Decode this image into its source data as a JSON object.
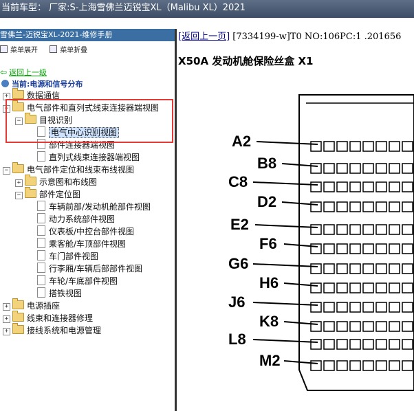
{
  "titlebar": {
    "text": "当前车型：  厂家:S-上海雪佛兰迈锐宝XL（Malibu XL）2021"
  },
  "left": {
    "header": "雪佛兰-迈锐宝XL-2021-维修手册",
    "toolbar": {
      "expand": "菜单展开",
      "collapse": "菜单折叠"
    },
    "back": "返回上一级",
    "current": "当前:电源和信号分布",
    "tree": [
      {
        "label": "数据通信",
        "type": "folder",
        "expander": "+"
      },
      {
        "label": "电气部件和直列式线束连接器端视图",
        "type": "folder",
        "expander": "−"
      },
      {
        "label": "目视识别",
        "type": "folder",
        "expander": "−"
      },
      {
        "label": "电气中心识别视图",
        "type": "doc",
        "selected": true
      },
      {
        "label": "部件连接器端视图",
        "type": "doc"
      },
      {
        "label": "直列式线束连接器端视图",
        "type": "doc"
      },
      {
        "label": "电气部件定位和线束布线视图",
        "type": "folder",
        "expander": "−"
      },
      {
        "label": "示意图和布线图",
        "type": "folder",
        "expander": "+"
      },
      {
        "label": "部件定位图",
        "type": "folder",
        "expander": "−"
      },
      {
        "label": "车辆前部/发动机舱部件视图",
        "type": "doc"
      },
      {
        "label": "动力系统部件视图",
        "type": "doc"
      },
      {
        "label": "仪表板/中控台部件视图",
        "type": "doc"
      },
      {
        "label": "乘客舱/车顶部件视图",
        "type": "doc"
      },
      {
        "label": "车门部件视图",
        "type": "doc"
      },
      {
        "label": "行李厢/车辆后部部件视图",
        "type": "doc"
      },
      {
        "label": "车轮/车底部件视图",
        "type": "doc"
      },
      {
        "label": "搭铁视图",
        "type": "doc"
      },
      {
        "label": "电源插座",
        "type": "folder",
        "expander": "+"
      },
      {
        "label": "线束和连接器修理",
        "type": "folder",
        "expander": "+"
      },
      {
        "label": "接线系统和电源管理",
        "type": "folder",
        "expander": "+"
      }
    ]
  },
  "right": {
    "back_link": "[返回上一页]",
    "meta": "[7334199-w]T0 NO:106PC:1 .201656",
    "heading": "X50A 发动机舱保险丝盒 X1",
    "diagram_labels": [
      "A2",
      "B8",
      "C8",
      "D2",
      "E2",
      "F6",
      "G6",
      "H6",
      "J6",
      "K8",
      "L8",
      "M2"
    ]
  }
}
